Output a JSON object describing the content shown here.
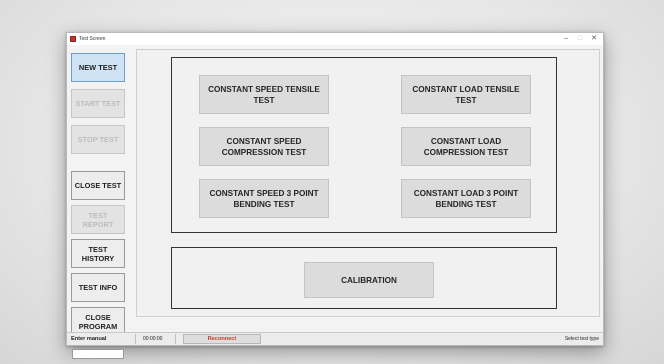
{
  "window": {
    "title": "Test Screen",
    "controls": {
      "minimize": "–",
      "maximize": "□",
      "close": "✕"
    }
  },
  "sidebar": {
    "new_test": "NEW TEST",
    "start_test": "START TEST",
    "stop_test": "STOP TEST",
    "close_test": "CLOSE TEST",
    "test_report": "TEST REPORT",
    "test_history": "TEST HISTORY",
    "test_info": "TEST INFO",
    "close_program": "CLOSE PROGRAM",
    "input_value": ""
  },
  "tests": {
    "speed_tensile": "CONSTANT SPEED TENSILE TEST",
    "load_tensile": "CONSTANT LOAD TENSILE TEST",
    "speed_compression": "CONSTANT SPEED COMPRESSION TEST",
    "load_compression": "CONSTANT LOAD COMPRESSION TEST",
    "speed_bending": "CONSTANT SPEED 3 POINT BENDING TEST",
    "load_bending": "CONSTANT LOAD 3 POINT BENDING TEST"
  },
  "calibration": {
    "label": "CALIBRATION"
  },
  "statusbar": {
    "mode": "Enter manual",
    "time": "00:00:00",
    "reconnect": "Reconnect",
    "message": "Select test type"
  },
  "colors": {
    "active_button": "#cfe3f5",
    "reconnect_text": "#c0392b",
    "app_icon": "#c0392b"
  }
}
